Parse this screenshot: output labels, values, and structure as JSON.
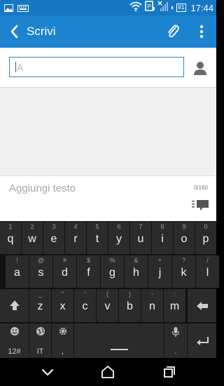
{
  "status_bar": {
    "time": "17:44",
    "battery_level": "81",
    "icons": [
      "image-icon",
      "keyboard-icon",
      "wifi-icon",
      "battery-saver-icon",
      "no-signal-icon",
      "battery-icon"
    ]
  },
  "app_bar": {
    "title": "Scrivi",
    "back_icon": "chevron-left-icon",
    "attach_icon": "paperclip-icon",
    "more_icon": "more-vertical-icon"
  },
  "recipient": {
    "value": "A",
    "contact_icon": "person-icon"
  },
  "compose": {
    "placeholder": "Aggiungi testo",
    "counter": "0/160",
    "send_icon": "send-message-icon"
  },
  "keyboard": {
    "row1": [
      {
        "main": "q",
        "alt": "1"
      },
      {
        "main": "w",
        "alt": "2"
      },
      {
        "main": "e",
        "alt": "3"
      },
      {
        "main": "r",
        "alt": "4"
      },
      {
        "main": "t",
        "alt": "5"
      },
      {
        "main": "y",
        "alt": "6"
      },
      {
        "main": "u",
        "alt": "7"
      },
      {
        "main": "i",
        "alt": "8"
      },
      {
        "main": "o",
        "alt": "9"
      },
      {
        "main": "p",
        "alt": "0"
      }
    ],
    "row2": [
      {
        "main": "a",
        "alt": "!"
      },
      {
        "main": "s",
        "alt": "@"
      },
      {
        "main": "d",
        "alt": "#"
      },
      {
        "main": "f",
        "alt": "$"
      },
      {
        "main": "g",
        "alt": "%"
      },
      {
        "main": "h",
        "alt": "&"
      },
      {
        "main": "j",
        "alt": "+"
      },
      {
        "main": "k",
        "alt": "?"
      },
      {
        "main": "l",
        "alt": "/"
      }
    ],
    "row3": [
      {
        "main": "z",
        "alt": "_"
      },
      {
        "main": "x",
        "alt": "\""
      },
      {
        "main": "c",
        "alt": "'"
      },
      {
        "main": "v",
        "alt": "("
      },
      {
        "main": "b",
        "alt": ")"
      },
      {
        "main": "n",
        "alt": "-"
      },
      {
        "main": "m",
        "alt": ":"
      }
    ],
    "row4": {
      "numbers_label": "12#",
      "language_label": "IT",
      "comma": ",",
      "period": "."
    }
  }
}
